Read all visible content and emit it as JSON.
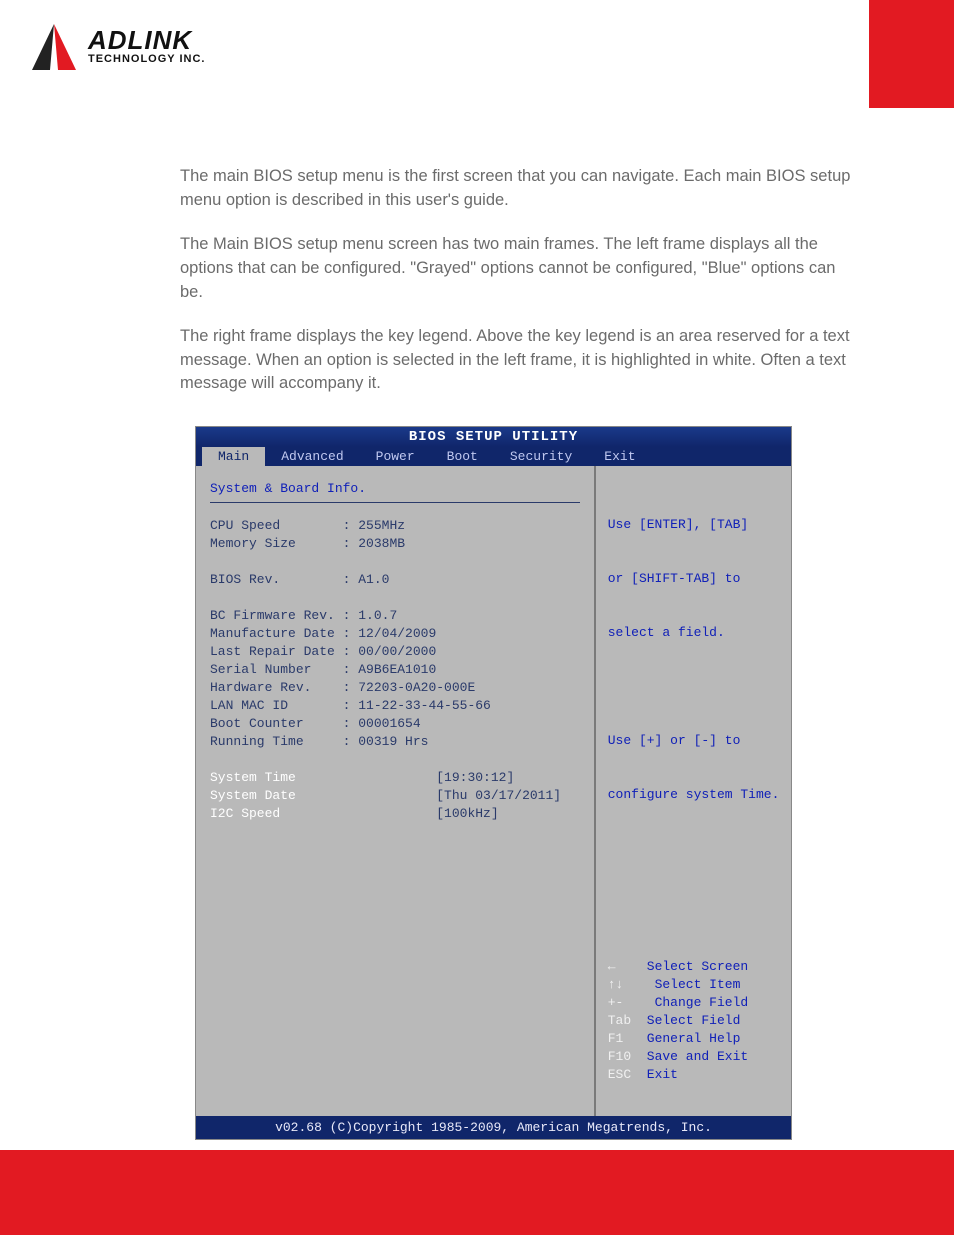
{
  "logo": {
    "name": "ADLINK",
    "sub": "TECHNOLOGY INC."
  },
  "paragraphs": {
    "p1": "The main BIOS setup menu is the first screen that you can navigate. Each main BIOS setup menu option is described in this user's guide.",
    "p2": "The Main BIOS setup menu screen has two main frames. The left frame displays all the options that can be configured. \"Grayed\" options cannot be configured, \"Blue\" options can be.",
    "p3": "The right frame displays the key legend. Above the key legend is an area reserved for a text message. When an option is selected in the left frame, it is highlighted in white. Often a text message will accompany it."
  },
  "bios": {
    "title": "BIOS SETUP UTILITY",
    "tabs": {
      "main": "Main",
      "advanced": "Advanced",
      "power": "Power",
      "boot": "Boot",
      "security": "Security",
      "exit": "Exit"
    },
    "left": {
      "section_head": "System & Board Info.",
      "cpu_speed_label": "CPU Speed        :",
      "cpu_speed_val": " 255MHz",
      "memory_size_label": "Memory Size      :",
      "memory_size_val": " 2038MB",
      "bios_rev_label": "BIOS Rev.        :",
      "bios_rev_val": " A1.0",
      "bc_fw_label": "BC Firmware Rev. :",
      "bc_fw_val": " 1.0.7",
      "manu_date_label": "Manufacture Date :",
      "manu_date_val": " 12/04/2009",
      "last_repair_label": "Last Repair Date :",
      "last_repair_val": " 00/00/2000",
      "serial_label": "Serial Number    :",
      "serial_val": " A9B6EA1010",
      "hw_rev_label": "Hardware Rev.    :",
      "hw_rev_val": " 72203-0A20-000E",
      "lan_mac_label": "LAN MAC ID       :",
      "lan_mac_val": " 11-22-33-44-55-66",
      "boot_counter_label": "Boot Counter     :",
      "boot_counter_val": " 00001654",
      "running_time_label": "Running Time     :",
      "running_time_val": " 00319 Hrs",
      "system_time_label": "System Time                  ",
      "system_time_val": "[19:30:12]",
      "system_date_label": "System Date                  ",
      "system_date_val": "[Thu 03/17/2011]",
      "i2c_speed_label": "I2C Speed                    ",
      "i2c_speed_val": "[100kHz]"
    },
    "right": {
      "help_l1": "Use [ENTER], [TAB]",
      "help_l2": "or [SHIFT-TAB] to",
      "help_l3": "select a field.",
      "help_l4": "Use [+] or [-] to",
      "help_l5": "configure system Time.",
      "key_select_screen_k": "←    ",
      "key_select_screen": "Select Screen",
      "key_select_item_k": "↑↓   ",
      "key_select_item": " Select Item",
      "key_change_field_k": "+-   ",
      "key_change_field": " Change Field",
      "key_select_field_k": "Tab  ",
      "key_select_field": "Select Field",
      "key_general_help_k": "F1   ",
      "key_general_help": "General Help",
      "key_save_exit_k": "F10  ",
      "key_save_exit": "Save and Exit",
      "key_exit_k": "ESC  ",
      "key_exit": "Exit"
    },
    "footer": "v02.68 (C)Copyright 1985-2009, American Megatrends, Inc."
  }
}
